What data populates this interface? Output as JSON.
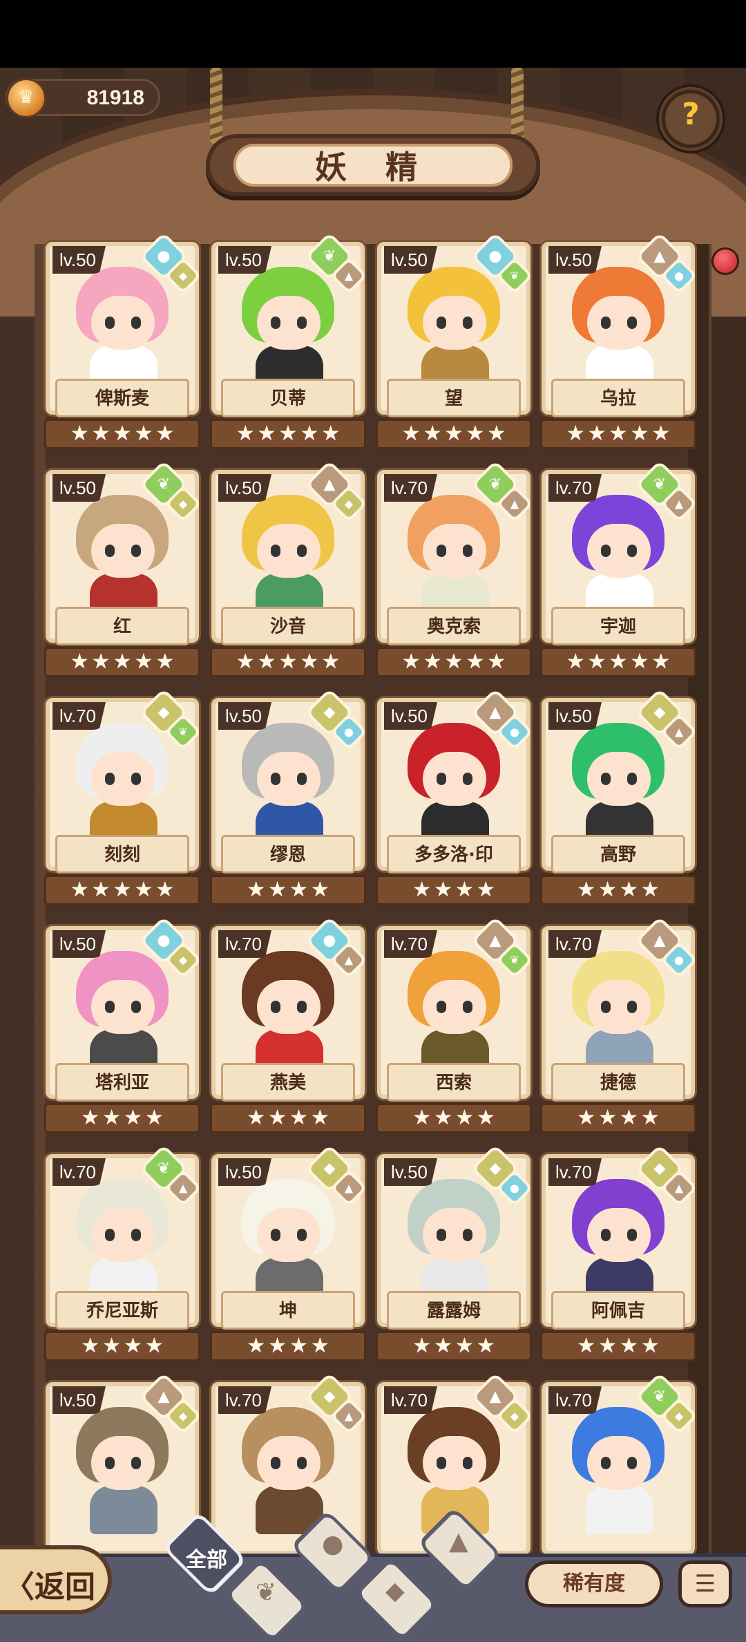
{
  "currency": {
    "value": "81918",
    "icon": "crown-coin-icon"
  },
  "title": "妖 精",
  "help_icon": "question-sprout-icon",
  "cards": [
    {
      "level": "lv.50",
      "name": "俾斯麦",
      "stars": 5,
      "elements": [
        "water",
        "earth"
      ],
      "hair": "#f7a6c0",
      "body": "#ffffff"
    },
    {
      "level": "lv.50",
      "name": "贝蒂",
      "stars": 5,
      "elements": [
        "leaf",
        "rock"
      ],
      "hair": "#7ccf3f",
      "body": "#2d2d2d"
    },
    {
      "level": "lv.50",
      "name": "望",
      "stars": 5,
      "elements": [
        "water",
        "leaf"
      ],
      "hair": "#f4c23a",
      "body": "#b88a3f"
    },
    {
      "level": "lv.50",
      "name": "乌拉",
      "stars": 5,
      "elements": [
        "rock",
        "water"
      ],
      "hair": "#ef7a35",
      "body": "#ffffff"
    },
    {
      "level": "lv.50",
      "name": "红",
      "stars": 5,
      "elements": [
        "leaf",
        "earth"
      ],
      "hair": "#c9a77e",
      "body": "#b5322f"
    },
    {
      "level": "lv.50",
      "name": "沙音",
      "stars": 5,
      "elements": [
        "rock",
        "earth"
      ],
      "hair": "#f0c545",
      "body": "#4c9c61"
    },
    {
      "level": "lv.70",
      "name": "奥克索",
      "stars": 5,
      "elements": [
        "leaf",
        "rock"
      ],
      "hair": "#f0a060",
      "body": "#e8e8d0"
    },
    {
      "level": "lv.70",
      "name": "宇迦",
      "stars": 5,
      "elements": [
        "leaf",
        "rock"
      ],
      "hair": "#7a45d8",
      "body": "#ffffff"
    },
    {
      "level": "lv.70",
      "name": "刻刻",
      "stars": 5,
      "elements": [
        "earth",
        "leaf"
      ],
      "hair": "#eeeeee",
      "body": "#c48a2e"
    },
    {
      "level": "lv.50",
      "name": "缪恩",
      "stars": 4,
      "elements": [
        "earth",
        "water"
      ],
      "hair": "#b9b9b9",
      "body": "#2f57a8"
    },
    {
      "level": "lv.50",
      "name": "多多洛·印",
      "stars": 4,
      "elements": [
        "rock",
        "water"
      ],
      "hair": "#c9222a",
      "body": "#2c2c2c"
    },
    {
      "level": "lv.50",
      "name": "高野",
      "stars": 4,
      "elements": [
        "earth",
        "rock"
      ],
      "hair": "#2fbf6a",
      "body": "#333333"
    },
    {
      "level": "lv.50",
      "name": "塔利亚",
      "stars": 4,
      "elements": [
        "water",
        "earth"
      ],
      "hair": "#ef93c4",
      "body": "#4b4b4b"
    },
    {
      "level": "lv.70",
      "name": "燕美",
      "stars": 4,
      "elements": [
        "water",
        "rock"
      ],
      "hair": "#6a3a22",
      "body": "#d3302f"
    },
    {
      "level": "lv.70",
      "name": "西索",
      "stars": 4,
      "elements": [
        "rock",
        "leaf"
      ],
      "hair": "#f0a23a",
      "body": "#6b5a2c"
    },
    {
      "level": "lv.70",
      "name": "捷德",
      "stars": 4,
      "elements": [
        "rock",
        "water"
      ],
      "hair": "#f0e08a",
      "body": "#8fa3b8"
    },
    {
      "level": "lv.70",
      "name": "乔尼亚斯",
      "stars": 4,
      "elements": [
        "leaf",
        "rock"
      ],
      "hair": "#e9e7d6",
      "body": "#f2f2f2"
    },
    {
      "level": "lv.50",
      "name": "坤",
      "stars": 4,
      "elements": [
        "earth",
        "rock"
      ],
      "hair": "#f6f3e8",
      "body": "#6c6c6c"
    },
    {
      "level": "lv.50",
      "name": "露露姆",
      "stars": 4,
      "elements": [
        "earth",
        "water"
      ],
      "hair": "#c2d1c7",
      "body": "#e8e8e8"
    },
    {
      "level": "lv.70",
      "name": "阿佩吉",
      "stars": 4,
      "elements": [
        "earth",
        "rock"
      ],
      "hair": "#8140d0",
      "body": "#3b3b66"
    },
    {
      "level": "lv.50",
      "name": "",
      "stars": 0,
      "elements": [
        "rock",
        "earth"
      ],
      "hair": "#8d7a5c",
      "body": "#7d8a99"
    },
    {
      "level": "lv.70",
      "name": "",
      "stars": 0,
      "elements": [
        "earth",
        "rock"
      ],
      "hair": "#b88f5e",
      "body": "#6b4a30"
    },
    {
      "level": "lv.70",
      "name": "",
      "stars": 0,
      "elements": [
        "rock",
        "earth"
      ],
      "hair": "#6a3f24",
      "body": "#e2b85a"
    },
    {
      "level": "lv.70",
      "name": "",
      "stars": 0,
      "elements": [
        "leaf",
        "earth"
      ],
      "hair": "#3d7be0",
      "body": "#f2f2f2"
    }
  ],
  "bottom": {
    "back_label": "〈返回",
    "tab_all_label": "全部",
    "sort_label": "稀有度",
    "order_icon": "sort-order-icon"
  }
}
